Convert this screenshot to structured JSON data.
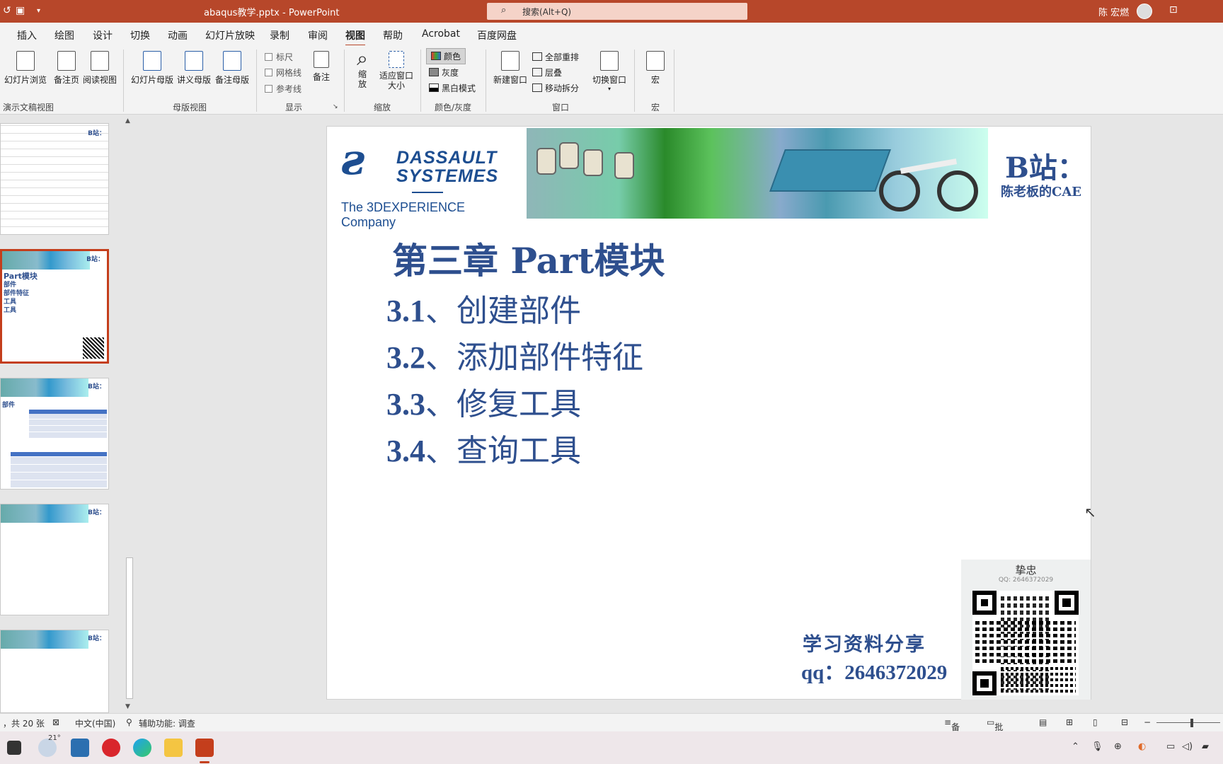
{
  "window": {
    "title": "abaqus教学.pptx  -  PowerPoint",
    "search_placeholder": "搜索(Alt+Q)",
    "user_name": "陈 宏燃"
  },
  "tabs": [
    "插入",
    "绘图",
    "设计",
    "切换",
    "动画",
    "幻灯片放映",
    "录制",
    "审阅",
    "视图",
    "帮助",
    "Acrobat",
    "百度网盘"
  ],
  "active_tab": "视图",
  "ribbon": {
    "presentation_views": {
      "label": "演示文稿视图",
      "buttons": [
        "幻灯片浏览",
        "备注页",
        "阅读视图"
      ]
    },
    "master_views": {
      "label": "母版视图",
      "buttons": [
        "幻灯片母版",
        "讲义母版",
        "备注母版"
      ]
    },
    "show": {
      "label": "显示",
      "checks": [
        "标尺",
        "网格线",
        "参考线"
      ],
      "notes": "备注"
    },
    "zoom": {
      "label": "缩放",
      "zoom": "缩放",
      "fit": "适应窗口大小"
    },
    "color": {
      "label": "颜色/灰度",
      "options": [
        "颜色",
        "灰度",
        "黑白模式"
      ]
    },
    "window": {
      "label": "窗口",
      "new": "新建窗口",
      "arrange": "全部重排",
      "cascade": "层叠",
      "split": "移动拆分",
      "switch": "切换窗口"
    },
    "macros": {
      "label": "宏",
      "button": "宏"
    }
  },
  "thumbnails": [
    {
      "lines": []
    },
    {
      "lines": [
        "Part模块",
        "部件",
        "部件特征",
        "工具",
        "工具"
      ]
    },
    {
      "lines": [
        "部件"
      ]
    },
    {
      "lines": []
    },
    {
      "lines": []
    }
  ],
  "slide": {
    "logo_line1": "DASSAULT",
    "logo_line2": "SYSTEMES",
    "logo_company": "The 3DEXPERIENCE Company",
    "bzhan": "B站：",
    "bzhan_sub": "陈老板的CAE",
    "heading": "第三章 Part模块",
    "items": [
      {
        "num": "3.1",
        "text": "、创建部件"
      },
      {
        "num": "3.2",
        "text": "、添加部件特征"
      },
      {
        "num": "3.3",
        "text": "、修复工具"
      },
      {
        "num": "3.4",
        "text": "、查询工具"
      }
    ],
    "share": "学习资料分享",
    "qq": "qq：2646372029",
    "qr_name": "挚忠",
    "qr_qq": "QQ: 2646372029"
  },
  "status": {
    "slides": "，共 20 张",
    "language": "中文(中国)",
    "accessibility": "辅助功能: 调查",
    "notes": "备注",
    "comments": "批注"
  },
  "taskbar": {
    "weather": "21°"
  }
}
